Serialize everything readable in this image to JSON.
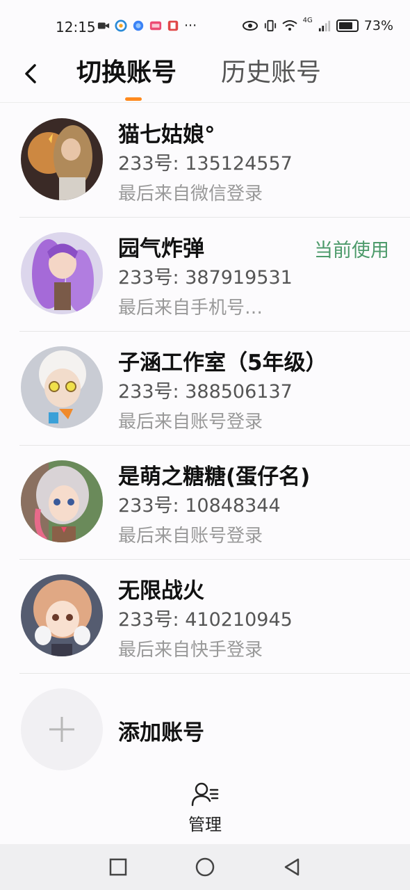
{
  "status_bar": {
    "time": "12:15",
    "battery": "73%",
    "network": "4G",
    "more_indicator": "···",
    "icons_left": [
      "video-camera-icon",
      "app-icon-1",
      "app-icon-2",
      "app-icon-3",
      "app-icon-4"
    ],
    "icons_right": [
      "eye-icon",
      "vibrate-icon",
      "wifi-icon",
      "signal-icon",
      "battery-icon"
    ]
  },
  "header": {
    "back_icon": "back-arrow-icon",
    "tab_active": "切换账号",
    "tab_inactive": "历史账号",
    "indicator_color": "#ff8a1f"
  },
  "accounts": [
    {
      "name": "猫七姑娘°",
      "id": "233号: 135124557",
      "login": "最后来自微信登录",
      "current": ""
    },
    {
      "name": "园气炸弹",
      "id": "233号: 387919531",
      "login": "最后来自手机号…",
      "current": "当前使用"
    },
    {
      "name": "子涵工作室（5年级）",
      "id": "233号: 388506137",
      "login": "最后来自账号登录",
      "current": ""
    },
    {
      "name": "是萌之糖糖(蛋仔名)",
      "id": "233号: 10848344",
      "login": "最后来自账号登录",
      "current": ""
    },
    {
      "name": "无限战火",
      "id": "233号: 410210945",
      "login": "最后来自快手登录",
      "current": ""
    }
  ],
  "current_color": "#4c9a6a",
  "add_account": {
    "label": "添加账号",
    "icon": "plus-icon"
  },
  "manage": {
    "label": "管理",
    "icon": "manage-user-icon"
  },
  "nav_bar": {
    "icons": [
      "recent-apps-icon",
      "home-icon",
      "back-icon"
    ]
  }
}
